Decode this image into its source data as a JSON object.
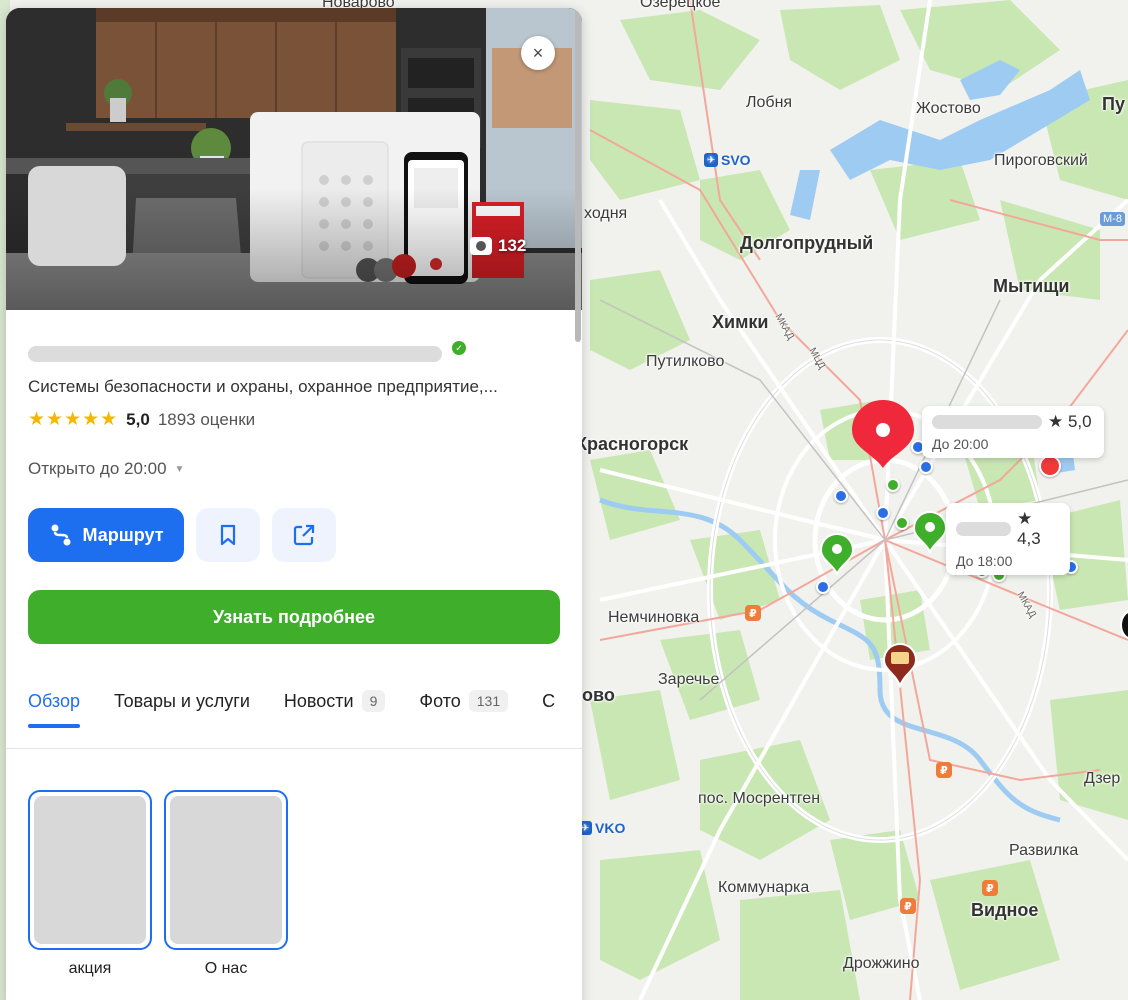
{
  "map": {
    "labels": [
      {
        "text": "Новарово"
      },
      {
        "text": "Озерецкое"
      },
      {
        "text": "Лобня"
      },
      {
        "text": "Жостово"
      },
      {
        "text": "Пу"
      },
      {
        "text": "Пироговский"
      },
      {
        "text": "ходня"
      },
      {
        "text": "Долгопрудный"
      },
      {
        "text": "Мытищи"
      },
      {
        "text": "Химки"
      },
      {
        "text": "Путилково"
      },
      {
        "text": "Красногорск"
      },
      {
        "text": "Немчиновка"
      },
      {
        "text": "Заречье"
      },
      {
        "text": "ово"
      },
      {
        "text": "пос. Мосрентген"
      },
      {
        "text": "Коммунарка"
      },
      {
        "text": "Развилка"
      },
      {
        "text": "Видное"
      },
      {
        "text": "Дрожжино"
      },
      {
        "text": "Дзер"
      }
    ],
    "road_labels": [
      "МКАД",
      "МЦД",
      "М-8"
    ],
    "airports": [
      {
        "code": "SVO"
      },
      {
        "code": "VKO"
      }
    ],
    "callouts": [
      {
        "rating": "★ 5,0",
        "hours": "До 20:00"
      },
      {
        "rating": "★ 4,3",
        "hours": "До 18:00"
      }
    ],
    "colors": {
      "water": "#9ecbf2",
      "forest": "#c9e7b3",
      "road": "#ffffff",
      "highway": "#f3a79a",
      "rail": "#b7b7b7"
    }
  },
  "panel": {
    "close_label": "×",
    "photo_count": "132",
    "category": "Системы безопасности и охраны, охранное предприятие,...",
    "stars": "★★★★★",
    "rating_value": "5,0",
    "rating_count": "1893 оценки",
    "hours": "Открыто до 20:00",
    "hours_chevron": "▼",
    "route_label": "Маршрут",
    "details_label": "Узнать подробнее",
    "tabs": [
      {
        "label": "Обзор"
      },
      {
        "label": "Товары и услуги"
      },
      {
        "label": "Новости",
        "badge": "9"
      },
      {
        "label": "Фото",
        "badge": "131"
      },
      {
        "label": "С"
      }
    ],
    "stories": [
      {
        "label": "акция"
      },
      {
        "label": "О нас"
      }
    ],
    "colors": {
      "primary": "#1e6ff0",
      "accent_green": "#3fae2a",
      "star": "#f5b800"
    }
  }
}
